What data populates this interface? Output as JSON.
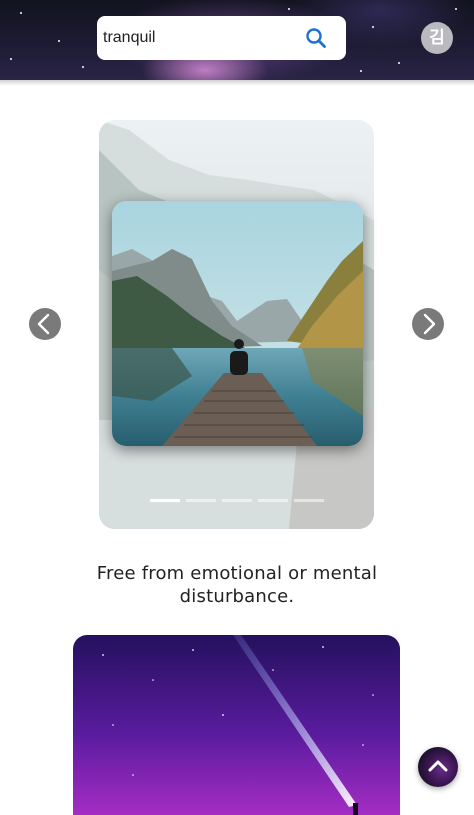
{
  "search": {
    "value": "tranquil",
    "icon": "search-icon"
  },
  "user": {
    "avatar_initial": "김"
  },
  "carousel": {
    "slide_count": 6,
    "active_index": 0,
    "prev_icon": "chevron-left-icon",
    "next_icon": "chevron-right-icon"
  },
  "word": {
    "definition": "Free from emotional or mental disturbance."
  },
  "scroll_top": {
    "icon": "chevron-up-icon"
  },
  "colors": {
    "search_icon": "#1e6fd9",
    "arrow_bg": "#7a7a7a",
    "text": "#222222"
  }
}
